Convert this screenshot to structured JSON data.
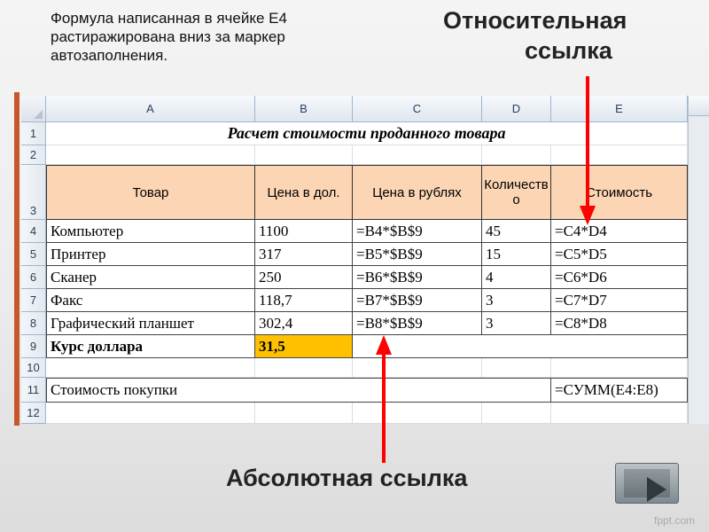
{
  "slide": {
    "description": "Формула написанная в ячейке Е4 растиражирована вниз за маркер автозаполнения.",
    "relative_title_line1": "Относительная",
    "relative_title_line2": "ссылка",
    "absolute_title": "Абсолютная ссылка",
    "watermark": "fppt.com"
  },
  "sheet": {
    "columns": [
      "A",
      "B",
      "C",
      "D",
      "E"
    ],
    "rows": [
      "1",
      "2",
      "3",
      "4",
      "5",
      "6",
      "7",
      "8",
      "9",
      "10",
      "11",
      "12"
    ],
    "title": "Расчет стоимости проданного товара",
    "headers": [
      "Товар",
      "Цена в дол.",
      "Цена в рублях",
      "Количество",
      "Стоимость"
    ],
    "data": [
      [
        "Компьютер",
        "1100",
        "=B4*$B$9",
        "45",
        "=C4*D4"
      ],
      [
        "Принтер",
        "317",
        "=B5*$B$9",
        "15",
        "=C5*D5"
      ],
      [
        "Сканер",
        "250",
        "=B6*$B$9",
        "4",
        "=C6*D6"
      ],
      [
        "Факс",
        "118,7",
        "=B7*$B$9",
        "3",
        "=C7*D7"
      ],
      [
        "Графический планшет",
        "302,4",
        "=B8*$B$9",
        "3",
        "=C8*D8"
      ]
    ],
    "rate_label": "Курс доллара",
    "rate_value": "31,5",
    "total_label": "Стоимость покупки",
    "total_formula": "=СУММ(E4:E8)"
  },
  "colors": {
    "header_fill": "#fcd5b4",
    "rate_fill": "#ffc000",
    "arrow": "#ff0000",
    "accent": "#c8562b"
  },
  "icons": {
    "next": "play-arrow-icon"
  }
}
